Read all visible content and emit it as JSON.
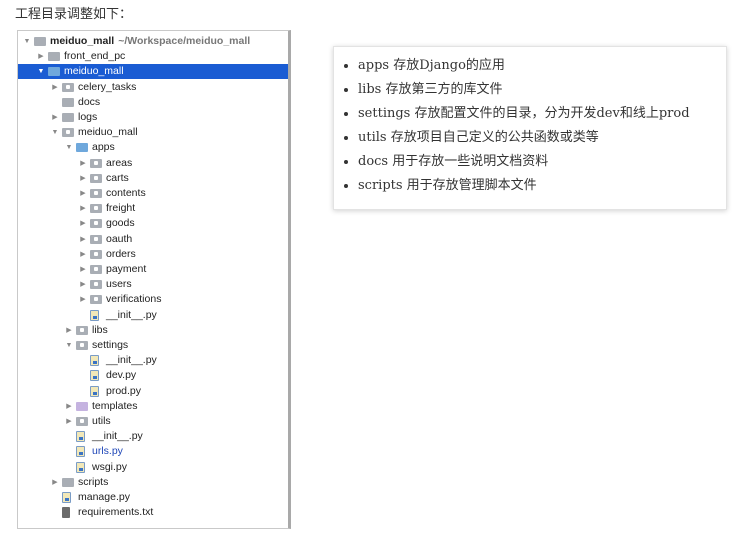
{
  "intro": "工程目录调整如下：",
  "tree": [
    {
      "label": "meiduo_mall",
      "path": "~/Workspace/meiduo_mall",
      "arrow": "down",
      "icon": "folder",
      "color": "#a9aeb5",
      "depth": 0,
      "bold": true
    },
    {
      "label": "front_end_pc",
      "arrow": "right",
      "icon": "folder",
      "color": "#a9aeb5",
      "depth": 1
    },
    {
      "label": "meiduo_mall",
      "arrow": "down",
      "icon": "folder",
      "color": "#6fa8dc",
      "depth": 1,
      "selected": true
    },
    {
      "label": "celery_tasks",
      "arrow": "right",
      "icon": "package",
      "color": "#a9aeb5",
      "depth": 2
    },
    {
      "label": "docs",
      "arrow": "",
      "icon": "folder",
      "color": "#a9aeb5",
      "depth": 2
    },
    {
      "label": "logs",
      "arrow": "right",
      "icon": "folder",
      "color": "#a9aeb5",
      "depth": 2
    },
    {
      "label": "meiduo_mall",
      "arrow": "down",
      "icon": "package",
      "color": "#a9aeb5",
      "depth": 2
    },
    {
      "label": "apps",
      "arrow": "down",
      "icon": "folder",
      "color": "#6fa8dc",
      "depth": 3
    },
    {
      "label": "areas",
      "arrow": "right",
      "icon": "package",
      "color": "#a9aeb5",
      "depth": 4
    },
    {
      "label": "carts",
      "arrow": "right",
      "icon": "package",
      "color": "#a9aeb5",
      "depth": 4
    },
    {
      "label": "contents",
      "arrow": "right",
      "icon": "package",
      "color": "#a9aeb5",
      "depth": 4
    },
    {
      "label": "freight",
      "arrow": "right",
      "icon": "package",
      "color": "#a9aeb5",
      "depth": 4
    },
    {
      "label": "goods",
      "arrow": "right",
      "icon": "package",
      "color": "#a9aeb5",
      "depth": 4
    },
    {
      "label": "oauth",
      "arrow": "right",
      "icon": "package",
      "color": "#a9aeb5",
      "depth": 4
    },
    {
      "label": "orders",
      "arrow": "right",
      "icon": "package",
      "color": "#a9aeb5",
      "depth": 4
    },
    {
      "label": "payment",
      "arrow": "right",
      "icon": "package",
      "color": "#a9aeb5",
      "depth": 4
    },
    {
      "label": "users",
      "arrow": "right",
      "icon": "package",
      "color": "#a9aeb5",
      "depth": 4
    },
    {
      "label": "verifications",
      "arrow": "right",
      "icon": "package",
      "color": "#a9aeb5",
      "depth": 4
    },
    {
      "label": "__init__.py",
      "arrow": "",
      "icon": "python-file",
      "depth": 4
    },
    {
      "label": "libs",
      "arrow": "right",
      "icon": "package",
      "color": "#a9aeb5",
      "depth": 3
    },
    {
      "label": "settings",
      "arrow": "down",
      "icon": "package",
      "color": "#a9aeb5",
      "depth": 3
    },
    {
      "label": "__init__.py",
      "arrow": "",
      "icon": "python-file",
      "depth": 4
    },
    {
      "label": "dev.py",
      "arrow": "",
      "icon": "python-file",
      "depth": 4
    },
    {
      "label": "prod.py",
      "arrow": "",
      "icon": "python-file",
      "depth": 4
    },
    {
      "label": "templates",
      "arrow": "right",
      "icon": "folder",
      "color": "#c5b3e0",
      "depth": 3
    },
    {
      "label": "utils",
      "arrow": "right",
      "icon": "package",
      "color": "#a9aeb5",
      "depth": 3
    },
    {
      "label": "__init__.py",
      "arrow": "",
      "icon": "python-file",
      "depth": 3
    },
    {
      "label": "urls.py",
      "arrow": "",
      "icon": "python-file",
      "depth": 3,
      "textColor": "#1f47b8"
    },
    {
      "label": "wsgi.py",
      "arrow": "",
      "icon": "python-file",
      "depth": 3
    },
    {
      "label": "scripts",
      "arrow": "right",
      "icon": "folder",
      "color": "#a9aeb5",
      "depth": 2
    },
    {
      "label": "manage.py",
      "arrow": "",
      "icon": "python-file",
      "depth": 2
    },
    {
      "label": "requirements.txt",
      "arrow": "",
      "icon": "text-file",
      "depth": 2
    }
  ],
  "notes": [
    "apps 存放Django的应用",
    "libs 存放第三方的库文件",
    "settings 存放配置文件的目录，分为开发dev和线上prod",
    "utils 存放项目自己定义的公共函数或类等",
    "docs 用于存放一些说明文档资料",
    "scripts 用于存放管理脚本文件"
  ]
}
